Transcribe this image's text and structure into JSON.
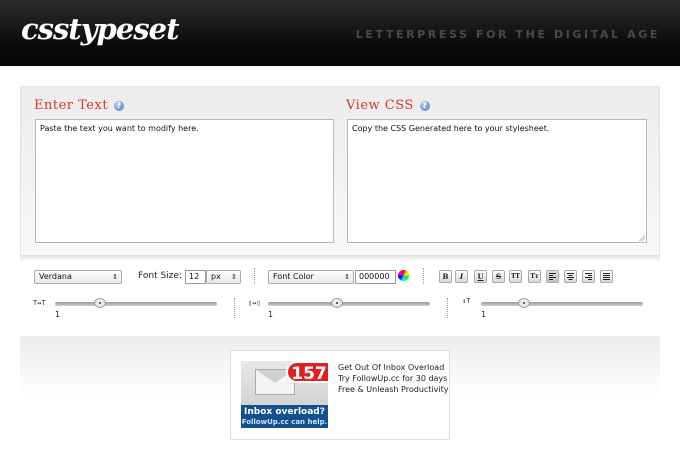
{
  "header": {
    "logo": "csstypeset",
    "tagline": "LETTERPRESS FOR THE DIGITAL AGE"
  },
  "enter": {
    "title": "Enter Text",
    "text": "Paste the text you want to modify here."
  },
  "view": {
    "title": "View CSS",
    "text": "Copy the CSS Generated here to your stylesheet."
  },
  "help_glyph": "?",
  "toolbar": {
    "font_family": "Verdana",
    "font_size_label": "Font Size:",
    "font_size_value": "12",
    "unit": "px",
    "font_color_label": "Font Color",
    "color_value": "000000",
    "format_buttons": [
      "B",
      "I",
      "U",
      "S",
      "TT",
      "Tт"
    ]
  },
  "sliders": [
    {
      "name": "letter-spacing",
      "value": "1"
    },
    {
      "name": "word-spacing",
      "value": "1"
    },
    {
      "name": "line-height",
      "value": "1"
    }
  ],
  "ad": {
    "badge": "157",
    "image_headline": "Inbox overload?",
    "image_sub": "FollowUp.cc can help.",
    "line1": "Get Out Of Inbox Overload",
    "line2": "Try FollowUp.cc for 30 days",
    "line3": "Free & Unleash Productivity"
  },
  "colors": {
    "accent": "#d33a2c",
    "header_bg": "#0a0a0a",
    "badge": "#e11f22",
    "ad_band": "#14508f"
  }
}
